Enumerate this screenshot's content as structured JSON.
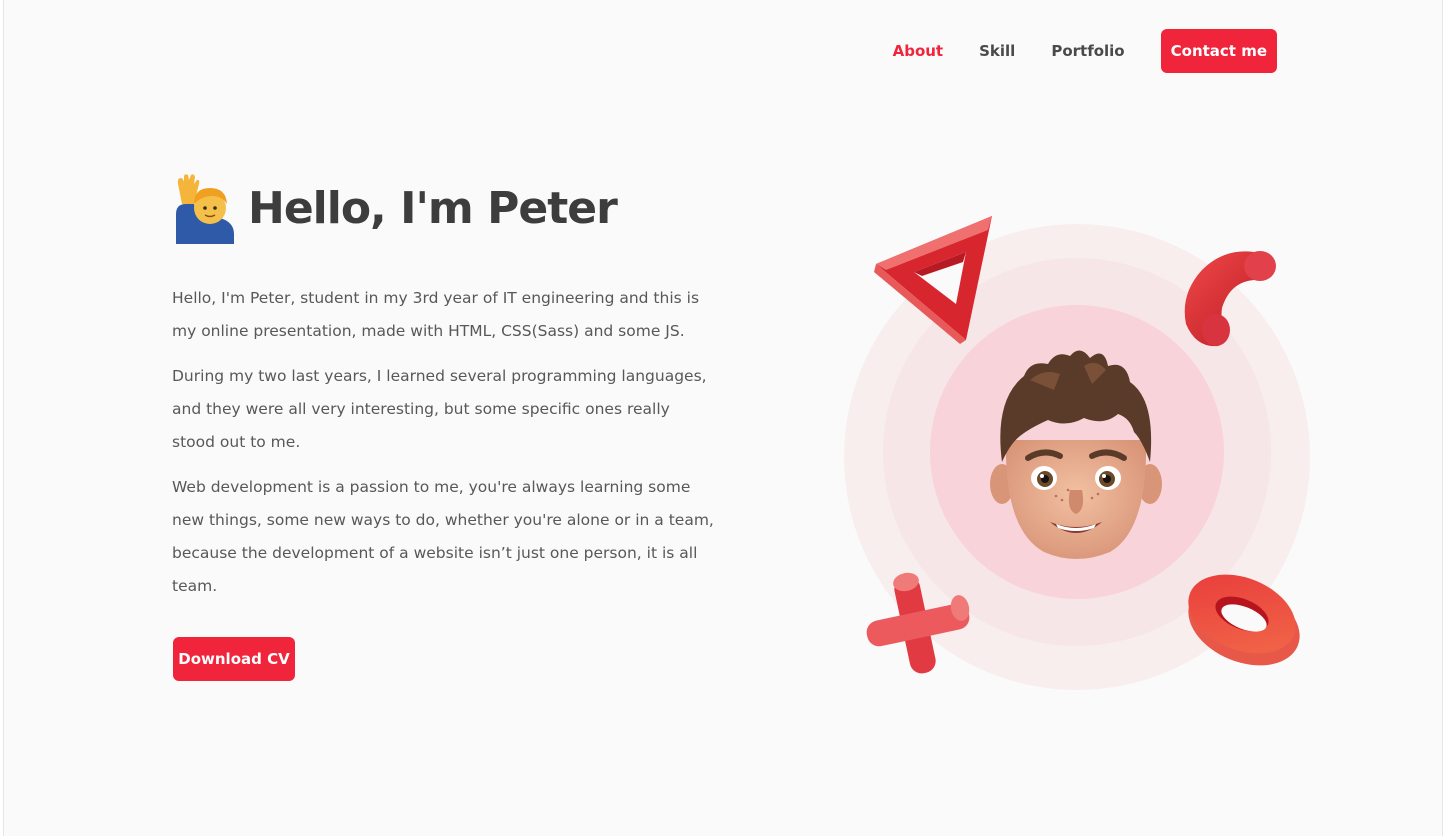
{
  "nav": {
    "items": [
      {
        "label": "About",
        "active": true
      },
      {
        "label": "Skill",
        "active": false
      },
      {
        "label": "Portfolio",
        "active": false
      }
    ],
    "contact_label": "Contact me"
  },
  "hero": {
    "title": "Hello, I'm Peter",
    "paragraphs": [
      "Hello, I'm Peter, student in my 3rd year of IT engineering and this is my online presentation, made with HTML, CSS(Sass) and some JS.",
      "During my two last years, I learned several programming languages, and they were all very interesting, but some specific ones really stood out to me.",
      "Web development is a passion to me, you're always learning some new things, some new ways to do, whether you're alone or in a team, because the development of a website isn’t just one person, it is all team."
    ],
    "download_label": "Download CV"
  },
  "icons": {
    "greeting": "person-raising-hand-icon",
    "avatar": "memoji-avatar",
    "shapes": [
      "triangle-shape",
      "arc-shape",
      "cross-shape",
      "ring-shape"
    ]
  },
  "colors": {
    "accent": "#f0243a",
    "text": "#3d3d3d",
    "body_text": "#585858",
    "background": "#fafafa",
    "circle_outer": "#f9eeee",
    "circle_mid": "#f7e6e7",
    "circle_inner": "#f8d3d9"
  }
}
